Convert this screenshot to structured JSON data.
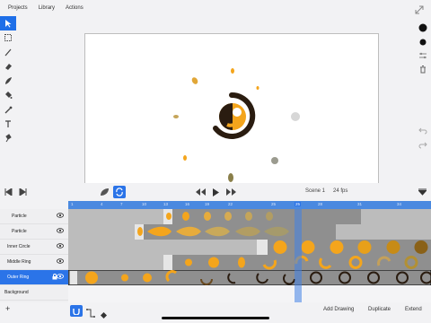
{
  "menu": {
    "projects": "Projects",
    "library": "Library",
    "actions": "Actions"
  },
  "tools_left": [
    "select-tool",
    "marquee-tool",
    "brush-tool",
    "eraser-tool",
    "fill-tool",
    "paint-bucket-tool",
    "eyedropper-tool",
    "text-tool",
    "stamp-tool"
  ],
  "tools_right": [
    "color-swatch",
    "brush-size",
    "adjust-icon",
    "trash-icon",
    "undo-icon",
    "redo-icon"
  ],
  "scene": {
    "name": "Scene 1",
    "fps": "24 fps"
  },
  "ruler_ticks": [
    "1",
    "4",
    "7",
    "10",
    "13",
    "16",
    "19",
    "22",
    "25",
    "28",
    "31",
    "34"
  ],
  "current_frame": "25",
  "layers": [
    {
      "name": "Particle",
      "indent": true,
      "active": false
    },
    {
      "name": "Particle",
      "indent": true,
      "active": false
    },
    {
      "name": "Inner Circle",
      "indent": false,
      "active": false
    },
    {
      "name": "Middle Ring",
      "indent": false,
      "active": false
    },
    {
      "name": "Outer Ring",
      "indent": false,
      "active": true
    },
    {
      "name": "Background",
      "indent": false,
      "active": false
    }
  ],
  "bottom": {
    "add_drawing": "Add Drawing",
    "duplicate": "Duplicate",
    "extend": "Extend"
  },
  "colors": {
    "accent": "#2b74e8",
    "orange": "#f4a51c",
    "dark": "#2a1c10",
    "olive": "#b29034"
  }
}
